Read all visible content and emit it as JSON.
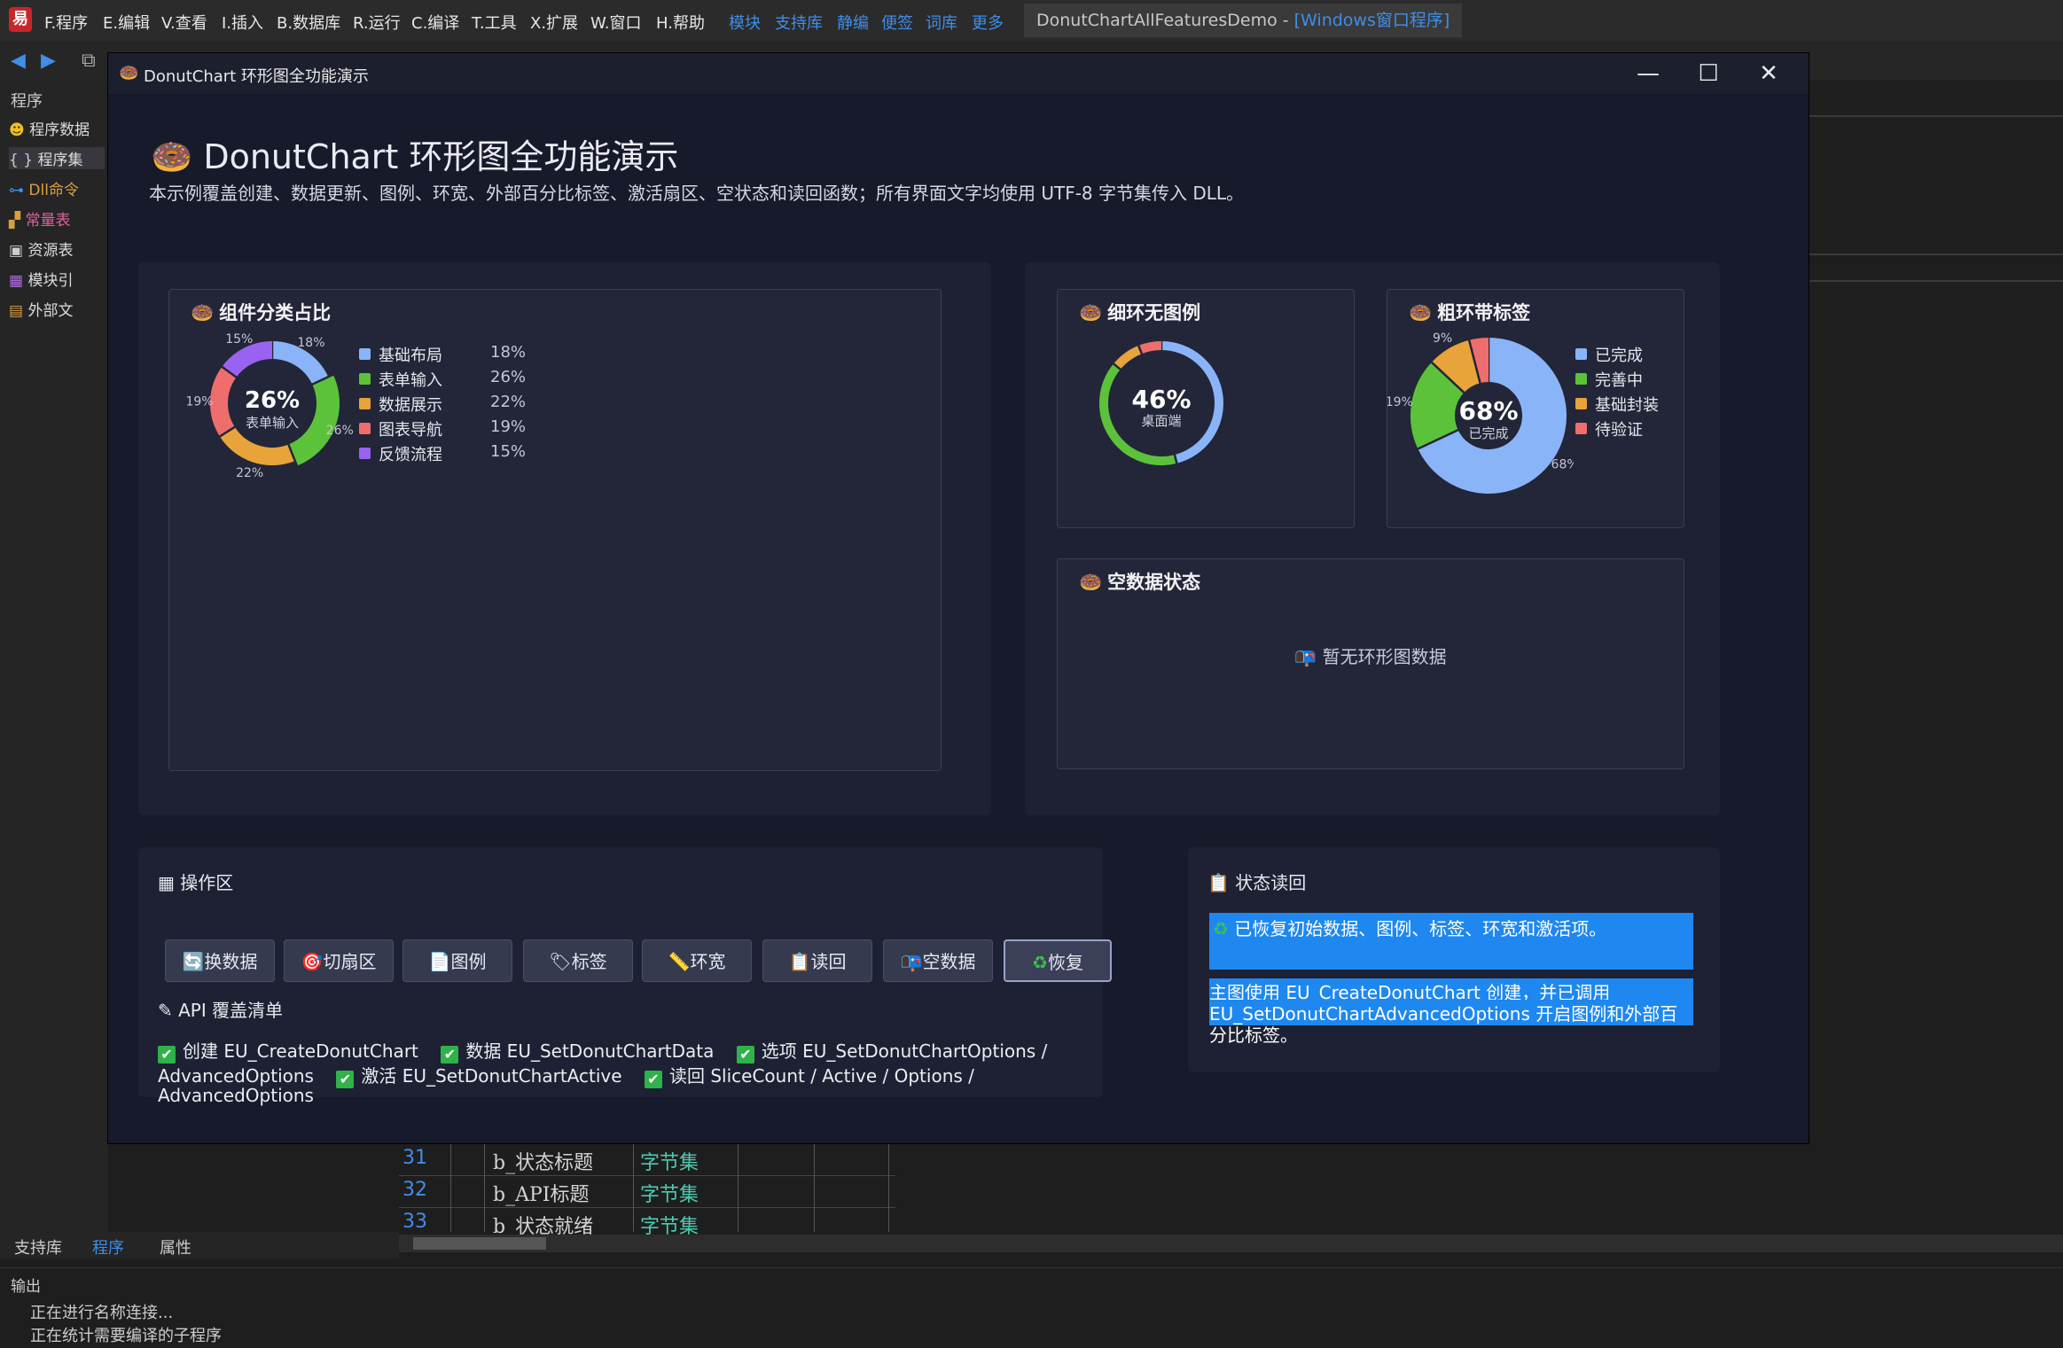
{
  "ide": {
    "menu": [
      "F.程序",
      "E.编辑",
      "V.查看",
      "I.插入",
      "B.数据库",
      "R.运行",
      "C.编译",
      "T.工具",
      "X.扩展",
      "W.窗口",
      "H.帮助"
    ],
    "links": [
      "模块",
      "支持库",
      "静编",
      "便签",
      "词库",
      "更多"
    ],
    "title_project": "DonutChartAllFeaturesDemo - ",
    "title_type": "[Windows窗口程序]",
    "left_panel": {
      "header": "程序",
      "items": [
        {
          "icon": "☻",
          "label": "程序数据",
          "color": "#e6e6e6"
        },
        {
          "icon": "{ }",
          "label": "程序集",
          "color": "#e6e6e6"
        },
        {
          "icon": "⊶",
          "label": "Dll命令",
          "color": "#d8a040"
        },
        {
          "icon": "▞",
          "label": "常量表",
          "color": "#e060a0"
        },
        {
          "icon": "▣",
          "label": "资源表",
          "color": "#e6e6e6"
        },
        {
          "icon": "▦",
          "label": "模块引",
          "color": "#e6e6e6"
        },
        {
          "icon": "▤",
          "label": "外部文",
          "color": "#e6e6e6"
        }
      ]
    },
    "code_rows": [
      {
        "num": "31",
        "name": "b_状态标题",
        "type": "字节集"
      },
      {
        "num": "32",
        "name": "b_API标题",
        "type": "字节集"
      },
      {
        "num": "33",
        "name": "b_状态就绪",
        "type": "字节集"
      }
    ],
    "bottom_tabs": [
      "支持库",
      "程序",
      "属性"
    ],
    "output": {
      "title": "输出",
      "lines": [
        "正在进行名称连接...",
        "正在统计需要编译的子程序"
      ]
    }
  },
  "window": {
    "title": "DonutChart 环形图全功能演示",
    "controls": [
      "—",
      "☐",
      "✕"
    ],
    "heading": "DonutChart 环形图全功能演示",
    "description": "本示例覆盖创建、数据更新、图例、环宽、外部百分比标签、激活扇区、空状态和读回函数；所有界面文字均使用 UTF-8 字节集传入 DLL。"
  },
  "card_icon": "🍩",
  "cards": {
    "main": {
      "title": "组件分类占比"
    },
    "thin": {
      "title": "细环无图例"
    },
    "thick": {
      "title": "粗环带标签"
    },
    "empty": {
      "title": "空数据状态",
      "message": "暂无环形图数据",
      "message_icon": "📭"
    }
  },
  "chart_data": [
    {
      "type": "pie",
      "title": "组件分类占比",
      "donut": true,
      "categories": [
        "基础布局",
        "表单输入",
        "数据展示",
        "图表导航",
        "反馈流程"
      ],
      "values": [
        18,
        26,
        22,
        19,
        15
      ],
      "colors": [
        "#8ab4f8",
        "#5cc23a",
        "#e8a33a",
        "#ee6e6e",
        "#9a62f0"
      ],
      "active_index": 1,
      "center_value": "26%",
      "center_label": "表单输入",
      "external_labels": true,
      "legend": "right",
      "legend_values": [
        "18%",
        "26%",
        "22%",
        "19%",
        "15%"
      ]
    },
    {
      "type": "pie",
      "title": "细环无图例",
      "donut": true,
      "categories": [
        "桌面端",
        "",
        "",
        ""
      ],
      "values": [
        46,
        40,
        8,
        6
      ],
      "colors": [
        "#8ab4f8",
        "#5cc23a",
        "#e8a33a",
        "#ee6e6e"
      ],
      "center_value": "46%",
      "center_label": "桌面端",
      "external_labels": false,
      "legend": "none"
    },
    {
      "type": "pie",
      "title": "粗环带标签",
      "donut": true,
      "categories": [
        "已完成",
        "完善中",
        "基础封装",
        "待验证"
      ],
      "values": [
        68,
        19,
        9,
        4
      ],
      "colors": [
        "#8ab4f8",
        "#5cc23a",
        "#e8a33a",
        "#ee6e6e"
      ],
      "center_value": "68%",
      "center_label": "已完成",
      "external_labels": true,
      "visible_label_values": [
        "68%",
        "19%",
        "9%"
      ],
      "legend": "right"
    },
    {
      "type": "pie",
      "title": "空数据状态",
      "donut": true,
      "categories": [],
      "values": []
    }
  ],
  "ops": {
    "title": "操作区",
    "title_icon": "▦",
    "buttons": [
      {
        "icon": "🔄",
        "label": "换数据"
      },
      {
        "icon": "🎯",
        "label": "切扇区"
      },
      {
        "icon": "📄",
        "label": "图例"
      },
      {
        "icon": "🏷",
        "label": "标签"
      },
      {
        "icon": "📏",
        "label": "环宽"
      },
      {
        "icon": "📋",
        "label": "读回"
      },
      {
        "icon": "📭",
        "label": "空数据"
      },
      {
        "icon": "♻",
        "label": "恢复"
      }
    ],
    "api_title": "API 覆盖清单",
    "api_icon": "✎",
    "api_lines": [
      [
        "创建 EU_CreateDonutChart",
        "数据 EU_SetDonutChartData",
        "选项 EU_SetDonutChartOptions /"
      ],
      [
        "AdvancedOptions",
        "激活 EU_SetDonutChartActive",
        "读回 SliceCount / Active / Options /"
      ],
      [
        "AdvancedOptions"
      ]
    ],
    "check_mark": "✔"
  },
  "status": {
    "title": "状态读回",
    "title_icon": "📋",
    "message_icon": "♻",
    "message": "已恢复初始数据、图例、标签、环宽和激活项。",
    "detail_lines": [
      "主图使用 EU_CreateDonutChart 创建，并已调用",
      "EU_SetDonutChartAdvancedOptions 开启图例和外部百",
      "分比标签。"
    ]
  }
}
